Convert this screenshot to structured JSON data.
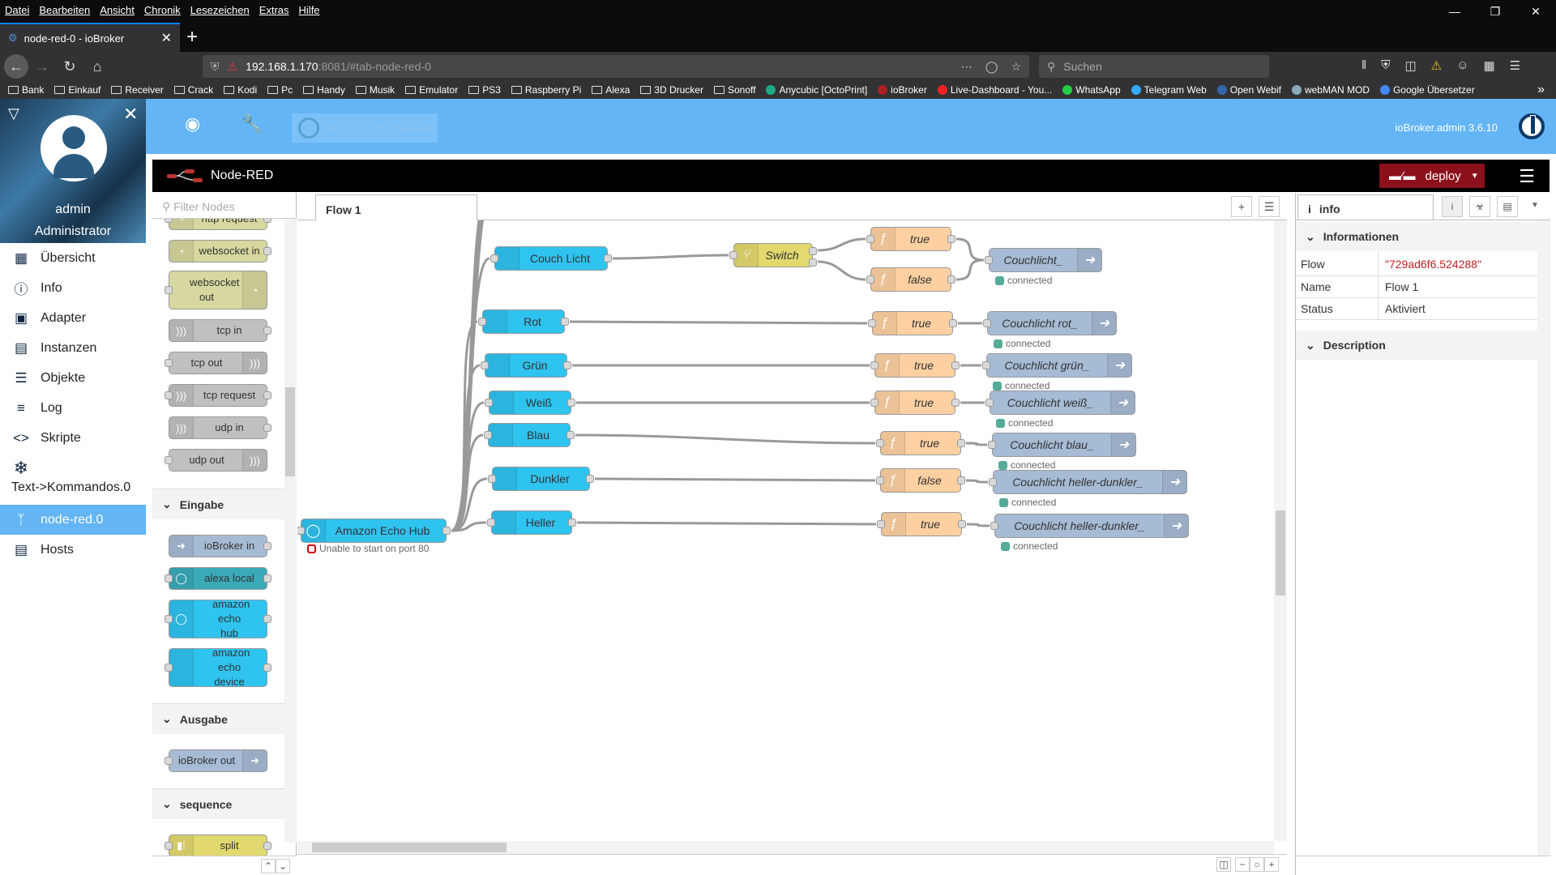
{
  "browser": {
    "menu": [
      "Datei",
      "Bearbeiten",
      "Ansicht",
      "Chronik",
      "Lesezeichen",
      "Extras",
      "Hilfe"
    ],
    "tab_title": "node-red-0 - ioBroker",
    "url_host": "192.168.1.170",
    "url_rest": ":8081/#tab-node-red-0",
    "search_placeholder": "Suchen",
    "bookmarks": [
      "Bank",
      "Einkauf",
      "Receiver",
      "Crack",
      "Kodi",
      "Pc",
      "Handy",
      "Musik",
      "Emulator",
      "PS3",
      "Raspberry Pi",
      "Alexa",
      "3D Drucker",
      "Sonoff",
      "Anycubic [OctoPrint]",
      "ioBroker",
      "Live-Dashboard - You...",
      "WhatsApp",
      "Telegram Web",
      "Open Webif",
      "webMAN MOD",
      "Google Übersetzer"
    ]
  },
  "iobroker": {
    "user": "admin",
    "role": "Administrator",
    "host_button": "HOST ELZERSHARK",
    "version": "ioBroker.admin 3.6.10",
    "nav": [
      {
        "label": "Übersicht",
        "icon": "grid-icon"
      },
      {
        "label": "Info",
        "icon": "info-icon"
      },
      {
        "label": "Adapter",
        "icon": "store-icon"
      },
      {
        "label": "Instanzen",
        "icon": "instances-icon"
      },
      {
        "label": "Objekte",
        "icon": "list-icon"
      },
      {
        "label": "Log",
        "icon": "log-icon"
      },
      {
        "label": "Skripte",
        "icon": "code-icon"
      },
      {
        "label": "Text->Kommandos.0",
        "icon": "snowflake-icon"
      },
      {
        "label": "node-red.0",
        "icon": "node-red-icon",
        "active": true
      },
      {
        "label": "Hosts",
        "icon": "hosts-icon"
      }
    ]
  },
  "nodered": {
    "title": "Node-RED",
    "deploy": "deploy",
    "filter_placeholder": "Filter Nodes",
    "palette": {
      "nodes_top": [
        "http request",
        "websocket in",
        "websocket out",
        "tcp in",
        "tcp out",
        "tcp request",
        "udp in",
        "udp out"
      ],
      "categories": [
        "Eingabe",
        "Ausgabe",
        "sequence"
      ],
      "eingabe": [
        "ioBroker in",
        "alexa local",
        "amazon echo hub",
        "amazon echo device"
      ],
      "ausgabe": [
        "ioBroker out"
      ],
      "sequence": [
        "split"
      ]
    },
    "flow_tab": "Flow 1",
    "flow": {
      "hub": {
        "label": "Amazon Echo Hub",
        "status": "Unable to start on port 80"
      },
      "devices": [
        "Couch Licht",
        "Rot",
        "Grün",
        "Weiß",
        "Blau",
        "Dunkler",
        "Heller"
      ],
      "switch": "Switch",
      "functions": [
        "true",
        "false",
        "true",
        "true",
        "true",
        "true",
        "false",
        "true"
      ],
      "outputs": [
        "Couchlicht_",
        "Couchlicht rot_",
        "Couchlicht grün_",
        "Couchlicht weiß_",
        "Couchlicht blau_",
        "Couchlicht heller-dunkler_",
        "Couchlicht heller-dunkler_"
      ],
      "output_status": "connected"
    },
    "sidebar": {
      "tab": "info",
      "section_info": "Informationen",
      "section_desc": "Description",
      "props": [
        {
          "key": "Flow",
          "value": "\"729ad6f6.524288\""
        },
        {
          "key": "Name",
          "value": "Flow 1"
        },
        {
          "key": "Status",
          "value": "Aktiviert"
        }
      ]
    }
  }
}
